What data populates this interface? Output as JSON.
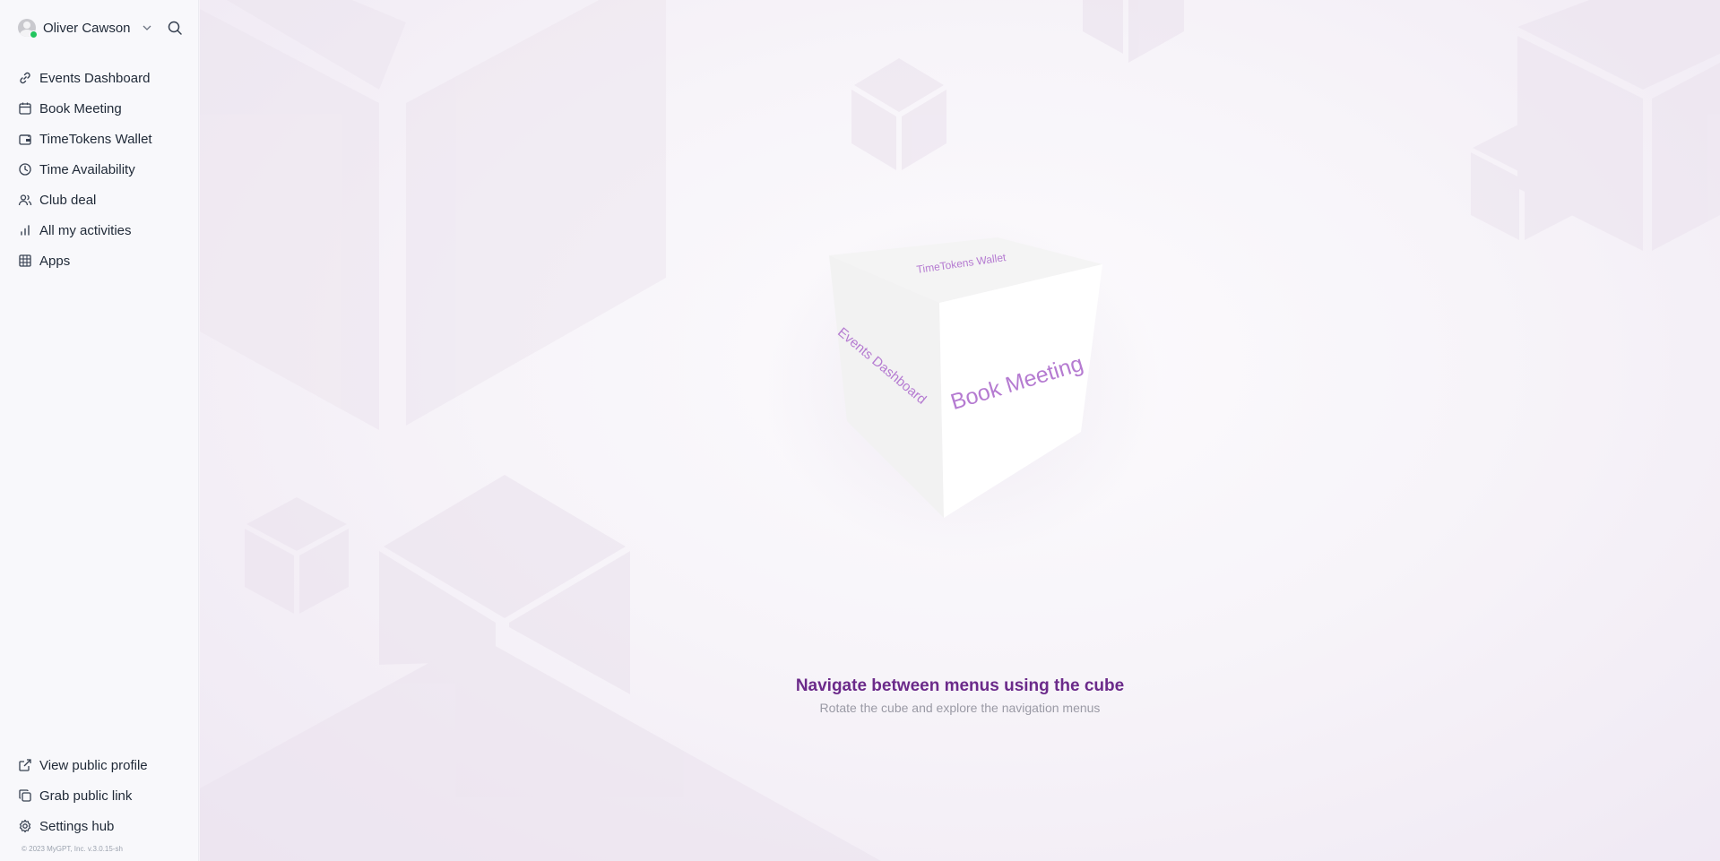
{
  "user": {
    "name": "Oliver Cawson"
  },
  "nav": {
    "items": [
      {
        "label": "Events Dashboard",
        "icon": "link-icon"
      },
      {
        "label": "Book Meeting",
        "icon": "calendar-icon"
      },
      {
        "label": "TimeTokens Wallet",
        "icon": "wallet-icon"
      },
      {
        "label": "Time Availability",
        "icon": "clock-icon"
      },
      {
        "label": "Club deal",
        "icon": "users-icon"
      },
      {
        "label": "All my activities",
        "icon": "bar-chart-icon"
      },
      {
        "label": "Apps",
        "icon": "grid-icon"
      }
    ]
  },
  "bottom_nav": {
    "items": [
      {
        "label": "View public profile",
        "icon": "external-link-icon"
      },
      {
        "label": "Grab public link",
        "icon": "copy-icon"
      },
      {
        "label": "Settings hub",
        "icon": "gear-icon"
      }
    ]
  },
  "footer": {
    "text": "© 2023 MyGPT, Inc. v.3.0.15-sh"
  },
  "cube": {
    "faces": {
      "top": "TimeTokens Wallet",
      "left": "Events Dashboard",
      "right": "Book Meeting"
    },
    "accent_color": "#b57bd1"
  },
  "caption": {
    "title": "Navigate between menus using the cube",
    "subtitle": "Rotate the cube and explore the navigation menus"
  },
  "colors": {
    "title": "#6b2a8a",
    "online": "#22c55e"
  }
}
